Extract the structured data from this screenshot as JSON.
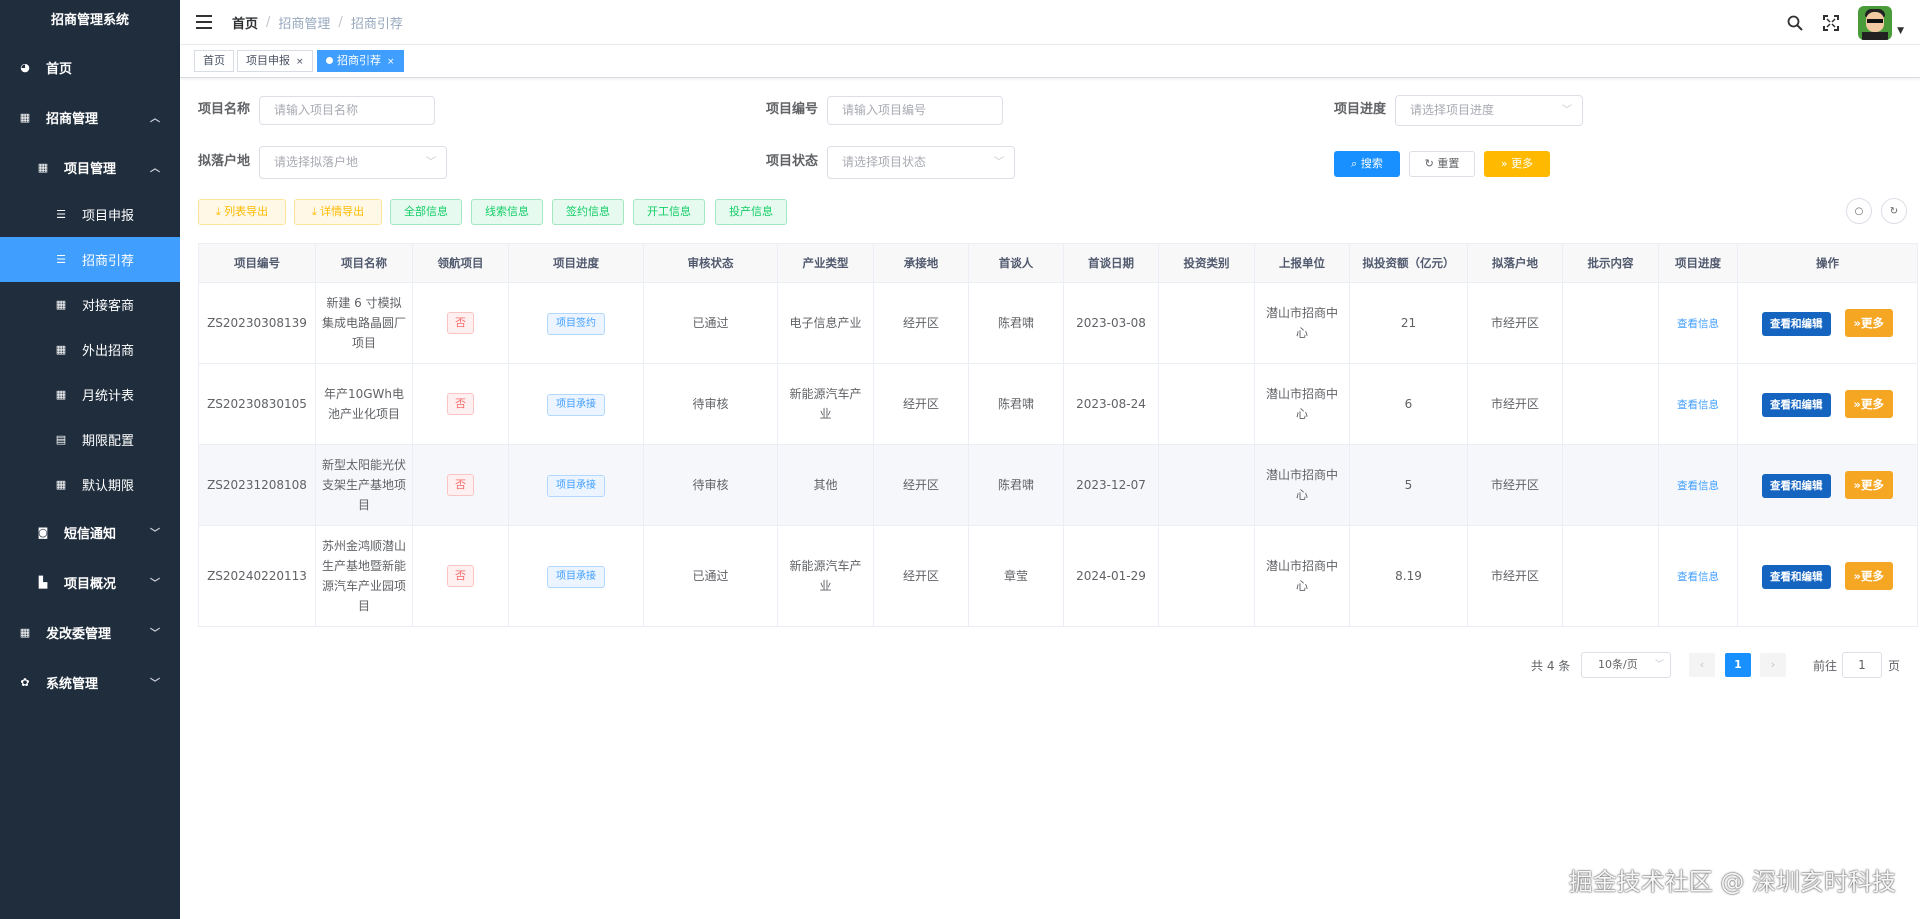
{
  "app": {
    "title": "招商管理系统"
  },
  "sidebar": {
    "items": [
      {
        "label": "首页"
      },
      {
        "label": "招商管理"
      },
      {
        "label": "项目管理"
      },
      {
        "label": "项目申报"
      },
      {
        "label": "招商引荐"
      },
      {
        "label": "对接客商"
      },
      {
        "label": "外出招商"
      },
      {
        "label": "月统计表"
      },
      {
        "label": "期限配置"
      },
      {
        "label": "默认期限"
      },
      {
        "label": "短信通知"
      },
      {
        "label": "项目概况"
      },
      {
        "label": "发改委管理"
      },
      {
        "label": "系统管理"
      }
    ]
  },
  "header": {
    "breadcrumb": [
      "首页",
      "招商管理",
      "招商引荐"
    ]
  },
  "tags": [
    {
      "label": "首页"
    },
    {
      "label": "项目申报"
    },
    {
      "label": "招商引荐"
    }
  ],
  "search": {
    "project_name": {
      "label": "项目名称",
      "placeholder": "请输入项目名称"
    },
    "project_no": {
      "label": "项目编号",
      "placeholder": "请输入项目编号"
    },
    "progress": {
      "label": "项目进度",
      "placeholder": "请选择项目进度"
    },
    "location": {
      "label": "拟落户地",
      "placeholder": "请选择拟落户地"
    },
    "status": {
      "label": "项目状态",
      "placeholder": "请选择项目状态"
    },
    "search_btn": "搜索",
    "reset_btn": "重置",
    "more_btn": "更多"
  },
  "toolbar": {
    "export_list": "列表导出",
    "export_detail": "详情导出",
    "all_info": "全部信息",
    "lead_info": "线索信息",
    "sign_info": "签约信息",
    "start_info": "开工信息",
    "production_info": "投产信息"
  },
  "table": {
    "columns": [
      "项目编号",
      "项目名称",
      "领航项目",
      "项目进度",
      "审核状态",
      "产业类型",
      "承接地",
      "首谈人",
      "首谈日期",
      "投资类别",
      "上报单位",
      "拟投资额（亿元）",
      "拟落户地",
      "批示内容",
      "项目进度",
      "操作"
    ],
    "view_label": "查看信息",
    "edit_label": "查看和编辑",
    "more_label": "更多",
    "rows": [
      {
        "no": "ZS20230308139",
        "name": "新建 6 寸模拟集成电路晶圆厂项目",
        "lead": "否",
        "stage": "项目签约",
        "audit": "已通过",
        "industry": "电子信息产业",
        "undertaker": "经开区",
        "person": "陈君啸",
        "date": "2023-03-08",
        "invest_type": "",
        "unit": "潜山市招商中心",
        "amount": "21",
        "location": "市经开区",
        "instruction": ""
      },
      {
        "no": "ZS20230830105",
        "name": "年产10GWh电池产业化项目",
        "lead": "否",
        "stage": "项目承接",
        "audit": "待审核",
        "industry": "新能源汽车产业",
        "undertaker": "经开区",
        "person": "陈君啸",
        "date": "2023-08-24",
        "invest_type": "",
        "unit": "潜山市招商中心",
        "amount": "6",
        "location": "市经开区",
        "instruction": ""
      },
      {
        "no": "ZS20231208108",
        "name": "新型太阳能光伏支架生产基地项目",
        "lead": "否",
        "stage": "项目承接",
        "audit": "待审核",
        "industry": "其他",
        "undertaker": "经开区",
        "person": "陈君啸",
        "date": "2023-12-07",
        "invest_type": "",
        "unit": "潜山市招商中心",
        "amount": "5",
        "location": "市经开区",
        "instruction": ""
      },
      {
        "no": "ZS20240220113",
        "name": "苏州金鸿顺潜山生产基地暨新能源汽车产业园项目",
        "lead": "否",
        "stage": "项目承接",
        "audit": "已通过",
        "industry": "新能源汽车产业",
        "undertaker": "经开区",
        "person": "章莹",
        "date": "2024-01-29",
        "invest_type": "",
        "unit": "潜山市招商中心",
        "amount": "8.19",
        "location": "市经开区",
        "instruction": ""
      }
    ]
  },
  "pagination": {
    "total": "共 4 条",
    "page_size": "10条/页",
    "current": "1",
    "goto_label": "前往",
    "goto_value": "1",
    "page_suffix": "页"
  },
  "watermark": "掘金技术社区 @ 深圳亥时科技"
}
